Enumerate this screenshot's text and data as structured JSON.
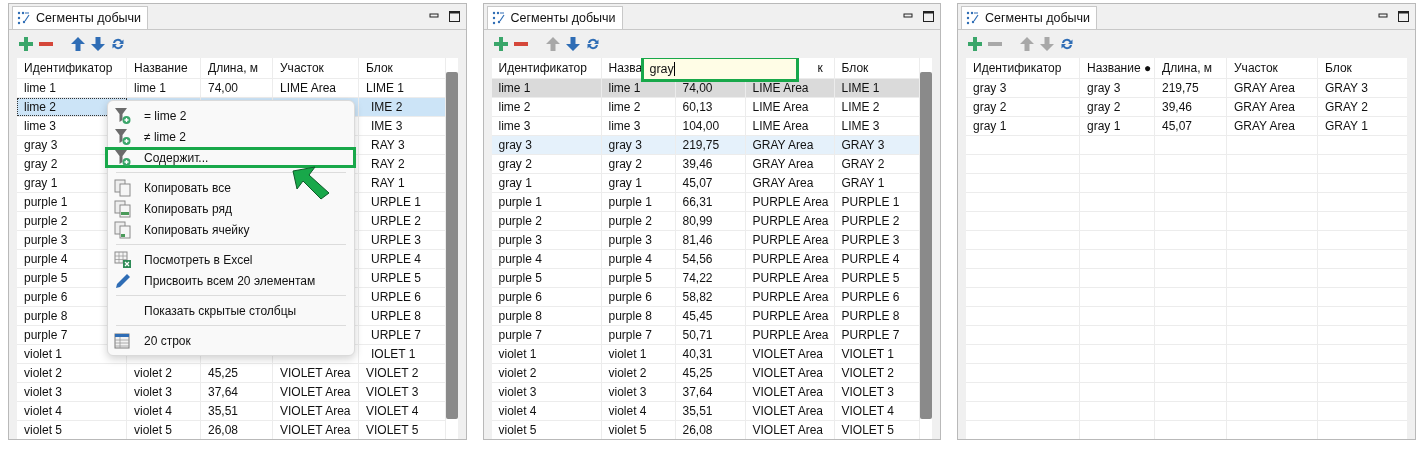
{
  "panels": [
    {
      "tab": {
        "title": "Сегменты добычи"
      },
      "toolbar": [
        {
          "kind": "add",
          "disabled": false
        },
        {
          "kind": "remove",
          "disabled": false
        },
        {
          "kind": "up",
          "disabled": false
        },
        {
          "kind": "down",
          "disabled": false
        },
        {
          "kind": "refresh",
          "disabled": false
        }
      ],
      "table": {
        "focused": true,
        "scrollbar": true,
        "columns": [
          "Идентификатор",
          "Название",
          "Длина, м",
          "Участок",
          "Блок"
        ],
        "rows": [
          {
            "cells": [
              "lime 1",
              "lime 1",
              "74,00",
              "LIME Area",
              "LIME 1"
            ],
            "selected": false,
            "hovered": false
          },
          {
            "cells": [
              "lime 2",
              null,
              null,
              null,
              "IME 2"
            ],
            "selected": true,
            "hovered": false
          },
          {
            "cells": [
              "lime 3",
              null,
              null,
              null,
              "IME 3"
            ],
            "selected": false,
            "hovered": false
          },
          {
            "cells": [
              "gray 3",
              null,
              null,
              null,
              "RAY 3"
            ],
            "selected": false,
            "hovered": false
          },
          {
            "cells": [
              "gray 2",
              null,
              null,
              null,
              "RAY 2"
            ],
            "selected": false,
            "hovered": false
          },
          {
            "cells": [
              "gray 1",
              null,
              null,
              null,
              "RAY 1"
            ],
            "selected": false,
            "hovered": false
          },
          {
            "cells": [
              "purple 1",
              null,
              null,
              null,
              "URPLE 1"
            ],
            "selected": false,
            "hovered": false
          },
          {
            "cells": [
              "purple 2",
              null,
              null,
              null,
              "URPLE 2"
            ],
            "selected": false,
            "hovered": false
          },
          {
            "cells": [
              "purple 3",
              null,
              null,
              null,
              "URPLE 3"
            ],
            "selected": false,
            "hovered": false
          },
          {
            "cells": [
              "purple 4",
              null,
              null,
              null,
              "URPLE 4"
            ],
            "selected": false,
            "hovered": false
          },
          {
            "cells": [
              "purple 5",
              null,
              null,
              null,
              "URPLE 5"
            ],
            "selected": false,
            "hovered": false
          },
          {
            "cells": [
              "purple 6",
              null,
              null,
              null,
              "URPLE 6"
            ],
            "selected": false,
            "hovered": false
          },
          {
            "cells": [
              "purple 8",
              null,
              null,
              null,
              "URPLE 8"
            ],
            "selected": false,
            "hovered": false
          },
          {
            "cells": [
              "purple 7",
              null,
              null,
              null,
              "URPLE 7"
            ],
            "selected": false,
            "hovered": false
          },
          {
            "cells": [
              "violet 1",
              null,
              null,
              null,
              "IOLET 1"
            ],
            "selected": false,
            "hovered": false
          },
          {
            "cells": [
              "violet 2",
              "violet 2",
              "45,25",
              "VIOLET Area",
              "VIOLET 2"
            ],
            "selected": false,
            "hovered": false
          },
          {
            "cells": [
              "violet 3",
              "violet 3",
              "37,64",
              "VIOLET Area",
              "VIOLET 3"
            ],
            "selected": false,
            "hovered": false
          },
          {
            "cells": [
              "violet 4",
              "violet 4",
              "35,51",
              "VIOLET Area",
              "VIOLET 4"
            ],
            "selected": false,
            "hovered": false
          },
          {
            "cells": [
              "violet 5",
              "violet 5",
              "26,08",
              "VIOLET Area",
              "VIOLET 5"
            ],
            "selected": false,
            "hovered": false
          }
        ]
      },
      "context_menu": {
        "items": [
          {
            "kind": "filter",
            "label": "= lime 2",
            "highlighted": false
          },
          {
            "kind": "filter",
            "label": "≠ lime 2",
            "highlighted": false
          },
          {
            "kind": "filter",
            "label": "Содержит...",
            "highlighted": true
          },
          {
            "kind": "separator"
          },
          {
            "kind": "copy_all",
            "label": "Копировать все",
            "highlighted": false
          },
          {
            "kind": "copy_row",
            "label": "Копировать ряд",
            "highlighted": false
          },
          {
            "kind": "copy_cell",
            "label": "Копировать ячейку",
            "highlighted": false
          },
          {
            "kind": "separator"
          },
          {
            "kind": "excel",
            "label": "Посмотреть в Excel",
            "highlighted": false
          },
          {
            "kind": "assign",
            "label": "Присвоить всем 20 элементам",
            "highlighted": false
          },
          {
            "kind": "separator"
          },
          {
            "kind": "plain",
            "label": "Показать скрытые столбцы",
            "highlighted": false
          },
          {
            "kind": "separator"
          },
          {
            "kind": "table",
            "label": "20 строк",
            "highlighted": false
          }
        ]
      }
    },
    {
      "tab": {
        "title": "Сегменты добычи"
      },
      "toolbar": [
        {
          "kind": "add",
          "disabled": false
        },
        {
          "kind": "remove",
          "disabled": false
        },
        {
          "kind": "up",
          "disabled": true
        },
        {
          "kind": "down",
          "disabled": false
        },
        {
          "kind": "refresh",
          "disabled": false
        }
      ],
      "filter_field": {
        "value": "gray",
        "highlighted": true
      },
      "table": {
        "focused": false,
        "scrollbar": true,
        "columns": [
          "Идентификатор",
          "Назва",
          null,
          "к",
          "Блок"
        ],
        "rows": [
          {
            "cells": [
              "lime 1",
              "lime 1",
              "74,00",
              "LIME Area",
              "LIME 1"
            ],
            "selected": true,
            "hovered": false
          },
          {
            "cells": [
              "lime 2",
              "lime 2",
              "60,13",
              "LIME Area",
              "LIME 2"
            ],
            "selected": false,
            "hovered": false
          },
          {
            "cells": [
              "lime 3",
              "lime 3",
              "104,00",
              "LIME Area",
              "LIME 3"
            ],
            "selected": false,
            "hovered": false
          },
          {
            "cells": [
              "gray 3",
              "gray 3",
              "219,75",
              "GRAY Area",
              "GRAY 3"
            ],
            "selected": false,
            "hovered": true
          },
          {
            "cells": [
              "gray 2",
              "gray 2",
              "39,46",
              "GRAY Area",
              "GRAY 2"
            ],
            "selected": false,
            "hovered": false
          },
          {
            "cells": [
              "gray 1",
              "gray 1",
              "45,07",
              "GRAY Area",
              "GRAY 1"
            ],
            "selected": false,
            "hovered": false
          },
          {
            "cells": [
              "purple 1",
              "purple 1",
              "66,31",
              "PURPLE Area",
              "PURPLE 1"
            ],
            "selected": false,
            "hovered": false
          },
          {
            "cells": [
              "purple 2",
              "purple 2",
              "80,99",
              "PURPLE Area",
              "PURPLE 2"
            ],
            "selected": false,
            "hovered": false
          },
          {
            "cells": [
              "purple 3",
              "purple 3",
              "81,46",
              "PURPLE Area",
              "PURPLE 3"
            ],
            "selected": false,
            "hovered": false
          },
          {
            "cells": [
              "purple 4",
              "purple 4",
              "54,56",
              "PURPLE Area",
              "PURPLE 4"
            ],
            "selected": false,
            "hovered": false
          },
          {
            "cells": [
              "purple 5",
              "purple 5",
              "74,22",
              "PURPLE Area",
              "PURPLE 5"
            ],
            "selected": false,
            "hovered": false
          },
          {
            "cells": [
              "purple 6",
              "purple 6",
              "58,82",
              "PURPLE Area",
              "PURPLE 6"
            ],
            "selected": false,
            "hovered": false
          },
          {
            "cells": [
              "purple 8",
              "purple 8",
              "45,45",
              "PURPLE Area",
              "PURPLE 8"
            ],
            "selected": false,
            "hovered": false
          },
          {
            "cells": [
              "purple 7",
              "purple 7",
              "50,71",
              "PURPLE Area",
              "PURPLE 7"
            ],
            "selected": false,
            "hovered": false
          },
          {
            "cells": [
              "violet 1",
              "violet 1",
              "40,31",
              "VIOLET Area",
              "VIOLET 1"
            ],
            "selected": false,
            "hovered": false
          },
          {
            "cells": [
              "violet 2",
              "violet 2",
              "45,25",
              "VIOLET Area",
              "VIOLET 2"
            ],
            "selected": false,
            "hovered": false
          },
          {
            "cells": [
              "violet 3",
              "violet 3",
              "37,64",
              "VIOLET Area",
              "VIOLET 3"
            ],
            "selected": false,
            "hovered": false
          },
          {
            "cells": [
              "violet 4",
              "violet 4",
              "35,51",
              "VIOLET Area",
              "VIOLET 4"
            ],
            "selected": false,
            "hovered": false
          },
          {
            "cells": [
              "violet 5",
              "violet 5",
              "26,08",
              "VIOLET Area",
              "VIOLET 5"
            ],
            "selected": false,
            "hovered": false
          }
        ]
      }
    },
    {
      "tab": {
        "title": "Сегменты добычи"
      },
      "toolbar": [
        {
          "kind": "add",
          "disabled": false
        },
        {
          "kind": "remove",
          "disabled": true
        },
        {
          "kind": "up",
          "disabled": true
        },
        {
          "kind": "down",
          "disabled": true
        },
        {
          "kind": "refresh",
          "disabled": false
        }
      ],
      "table": {
        "scrollbar": false,
        "columns": [
          "Идентификатор",
          "Название ●",
          "Длина, м",
          "Участок",
          "Блок"
        ],
        "rows": [
          {
            "cells": [
              "gray 3",
              "gray 3",
              "219,75",
              "GRAY Area",
              "GRAY 3"
            ],
            "selected": false,
            "hovered": false
          },
          {
            "cells": [
              "gray 2",
              "gray 2",
              "39,46",
              "GRAY Area",
              "GRAY 2"
            ],
            "selected": false,
            "hovered": false
          },
          {
            "cells": [
              "gray 1",
              "gray 1",
              "45,07",
              "GRAY Area",
              "GRAY 1"
            ],
            "selected": false,
            "hovered": false
          }
        ]
      }
    }
  ]
}
